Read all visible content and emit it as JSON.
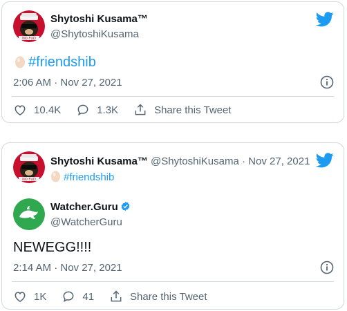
{
  "tweet1": {
    "author_name": "Shytoshi Kusama™",
    "author_handle": "@ShytoshiKusama",
    "text": "#friendshib",
    "time": "2:06 AM · Nov 27, 2021",
    "likes": "10.4K",
    "replies": "1.3K",
    "share_label": "Share this Tweet"
  },
  "tweet2": {
    "author_name": "Shytoshi Kusama™",
    "author_handle": "@ShytoshiKusama",
    "date": " · Nov 27, 2021",
    "text": "#friendshib",
    "quoted": {
      "author_name": "Watcher.Guru",
      "author_handle": "@WatcherGuru",
      "text": "NEWEGG!!!!",
      "time": "2:14 AM · Nov 27, 2021",
      "likes": "1K",
      "replies": "41",
      "share_label": "Share this Tweet"
    }
  },
  "avatar_badge_text": "NO FUD",
  "colors": {
    "accent": "#1d9bf0",
    "muted": "#536471",
    "border": "#cfd9de",
    "watcher_green": "#2fa84f"
  },
  "icons": [
    "twitter-bird-icon",
    "egg-icon",
    "info-icon",
    "heart-icon",
    "reply-icon",
    "share-icon",
    "verified-icon"
  ]
}
